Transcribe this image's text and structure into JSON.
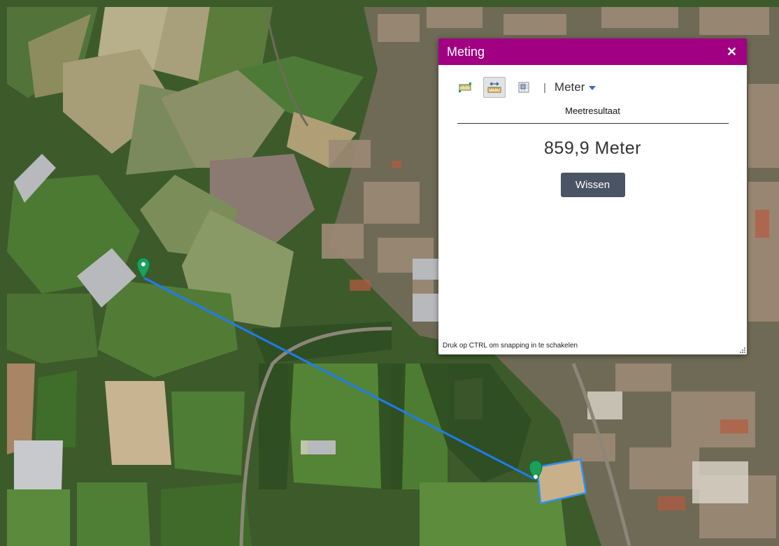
{
  "colors": {
    "header": "#a10082",
    "measure_line": "#1e7cf0",
    "marker": "#1aa05a",
    "button": "#4a5464"
  },
  "panel": {
    "title": "Meting",
    "close_icon": "close-icon",
    "tools": [
      {
        "name": "area-measure-icon",
        "active": false
      },
      {
        "name": "distance-measure-icon",
        "active": true
      },
      {
        "name": "location-measure-icon",
        "active": false
      }
    ],
    "unit_separator": "|",
    "unit": "Meter",
    "result_label": "Meetresultaat",
    "result_value": "859,9 Meter",
    "clear_label": "Wissen",
    "hint_prefix": "Druk op ",
    "hint_key": "CTRL",
    "hint_suffix": " om snapping in te schakelen"
  }
}
